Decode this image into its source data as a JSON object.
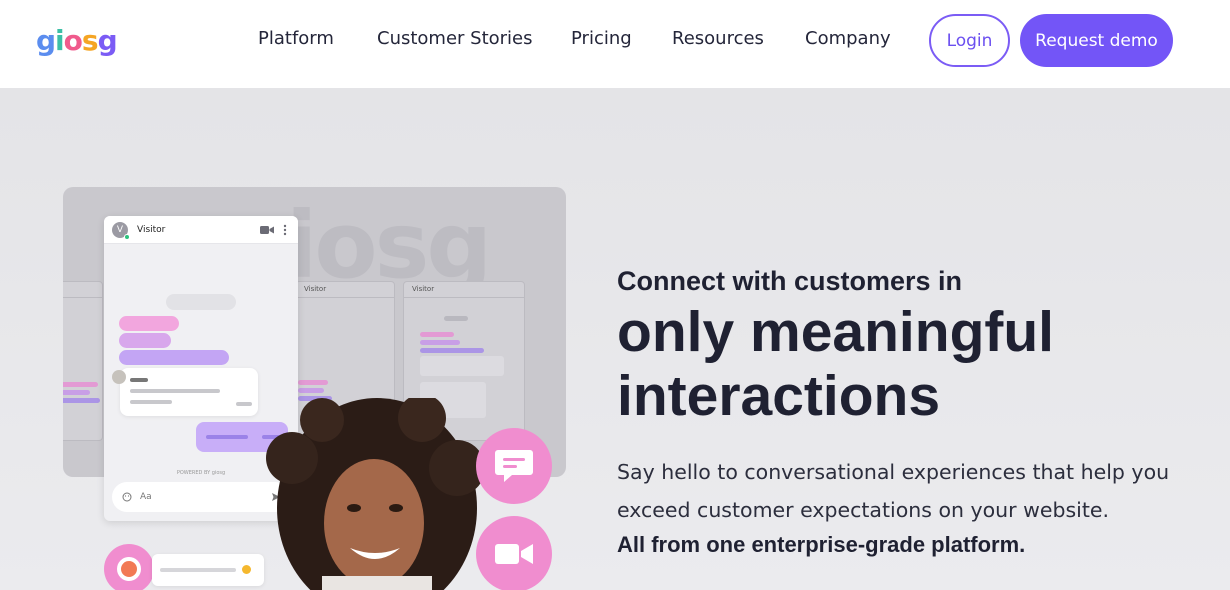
{
  "brand": {
    "logo_letters": [
      "g",
      "i",
      "o",
      "s",
      "g"
    ],
    "logo_colors": [
      "#5b8def",
      "#3dbfa6",
      "#f05a8c",
      "#f5a524",
      "#7b5cf5"
    ],
    "accent": "#7355f7",
    "pink": "#f08dcf"
  },
  "nav": {
    "items": [
      "Platform",
      "Customer Stories",
      "Pricing",
      "Resources",
      "Company"
    ],
    "login": "Login",
    "request_demo": "Request demo"
  },
  "mockup": {
    "visitor_label": "Visitor",
    "avatar_initial": "V",
    "input_placeholder": "Aa",
    "powered_by": "POWERED BY giosg",
    "watermark": "giosg"
  },
  "hero": {
    "subheading": "Connect with customers in",
    "title": "only meaningful interactions",
    "description": "Say hello to conversational experiences that help you exceed customer expectations on your website.",
    "strong": "All from one enterprise-grade platform."
  },
  "icons": {
    "chat": "chat-bubble-icon",
    "video": "video-camera-icon",
    "more": "more-vertical-icon",
    "send": "send-icon",
    "emoji": "emoji-icon"
  }
}
